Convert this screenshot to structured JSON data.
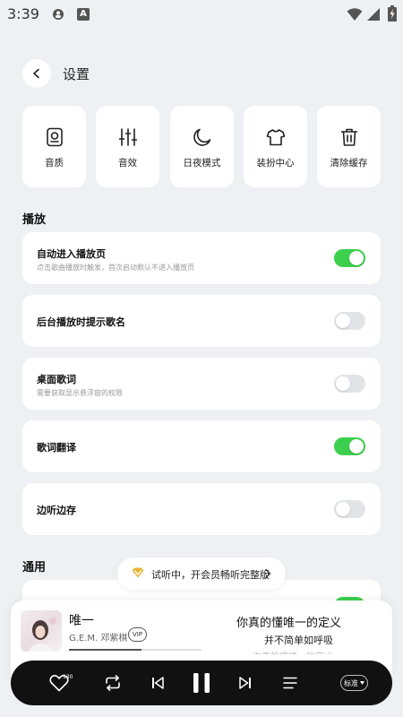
{
  "status_bar": {
    "time": "3:39",
    "notification_badge": "A"
  },
  "header": {
    "title": "设置"
  },
  "quick_tiles": [
    {
      "icon": "speaker-icon",
      "label": "音质"
    },
    {
      "icon": "equalizer-icon",
      "label": "音效"
    },
    {
      "icon": "moon-icon",
      "label": "日夜模式"
    },
    {
      "icon": "tshirt-icon",
      "label": "装扮中心"
    },
    {
      "icon": "trash-icon",
      "label": "清除缓存"
    }
  ],
  "sections": {
    "playback": "播放",
    "general": "通用"
  },
  "settings": [
    {
      "title": "自动进入播放页",
      "subtitle": "点击歌曲播放时触发，首次启动默认不进入播放页",
      "enabled": true
    },
    {
      "title": "后台播放时提示歌名",
      "subtitle": "",
      "enabled": false
    },
    {
      "title": "桌面歌词",
      "subtitle": "需要获取显示悬浮窗的权限",
      "enabled": false
    },
    {
      "title": "歌词翻译",
      "subtitle": "",
      "enabled": true
    },
    {
      "title": "边听边存",
      "subtitle": "",
      "enabled": false
    }
  ],
  "trial_banner": {
    "text": "试听中，开会员畅听完整版"
  },
  "player": {
    "song_title": "唯一",
    "artist": "G.E.M. 邓紫棋",
    "vip_badge": "VIP",
    "progress": 0.55,
    "lyrics": [
      "你真的懂唯一的定义",
      "并不简单如呼吸",
      "你真的懂唯一的定义"
    ],
    "like_count": "130",
    "quality_label": "标准"
  },
  "colors": {
    "background": "#eef0f3",
    "toggle_on": "#3ccf4e",
    "toggle_off": "#e3e4e8",
    "control_bar": "#111111"
  }
}
